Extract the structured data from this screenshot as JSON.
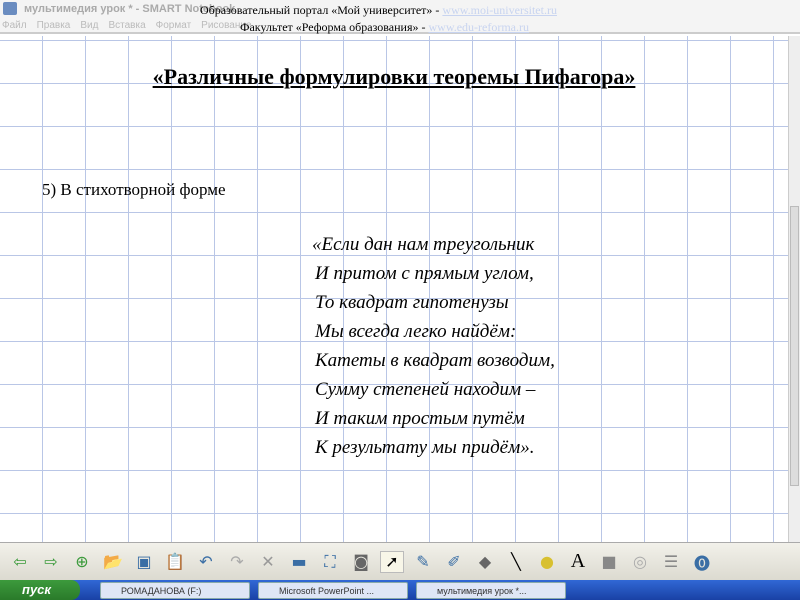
{
  "window": {
    "title": "мультимедия урок * - SMART Notebook",
    "menu": [
      "Файл",
      "Правка",
      "Вид",
      "Вставка",
      "Формат",
      "Рисование"
    ]
  },
  "header": {
    "line1": "Образовательный портал «Мой университет» - ",
    "link1": "www.moi-universitet.ru",
    "line2": "Факультет «Реформа образования» - ",
    "link2": "www.edu-reforma.ru"
  },
  "slide": {
    "title": "«Различные формулировки теоремы Пифагора»",
    "subtitle": "5) В стихотворной форме",
    "poem": [
      "«Если дан нам треугольник",
      "И притом с прямым углом,",
      "То квадрат гипотенузы",
      "Мы всегда легко найдём:",
      "Катеты в квадрат возводим,",
      "Сумму степеней находим –",
      "И таким простым путём",
      "К результату мы придём»."
    ]
  },
  "toolbar": {
    "icons": [
      "back-icon",
      "forward-icon",
      "add-page-icon",
      "open-icon",
      "save-icon",
      "paste-icon",
      "undo-icon",
      "redo-icon",
      "delete-icon",
      "screen-shade-icon",
      "fullscreen-icon",
      "capture-icon",
      "select-icon",
      "pen-icon",
      "highlighter-icon",
      "eraser-icon",
      "line-icon",
      "fill-icon",
      "text-icon",
      "properties-icon",
      "shapes-icon",
      "more-icon",
      "help-icon"
    ]
  },
  "taskbar": {
    "start": "пуск",
    "tasks": [
      "РОМАДАНОВА (F:)",
      "Microsoft PowerPoint ...",
      "мультимедия урок *..."
    ]
  }
}
